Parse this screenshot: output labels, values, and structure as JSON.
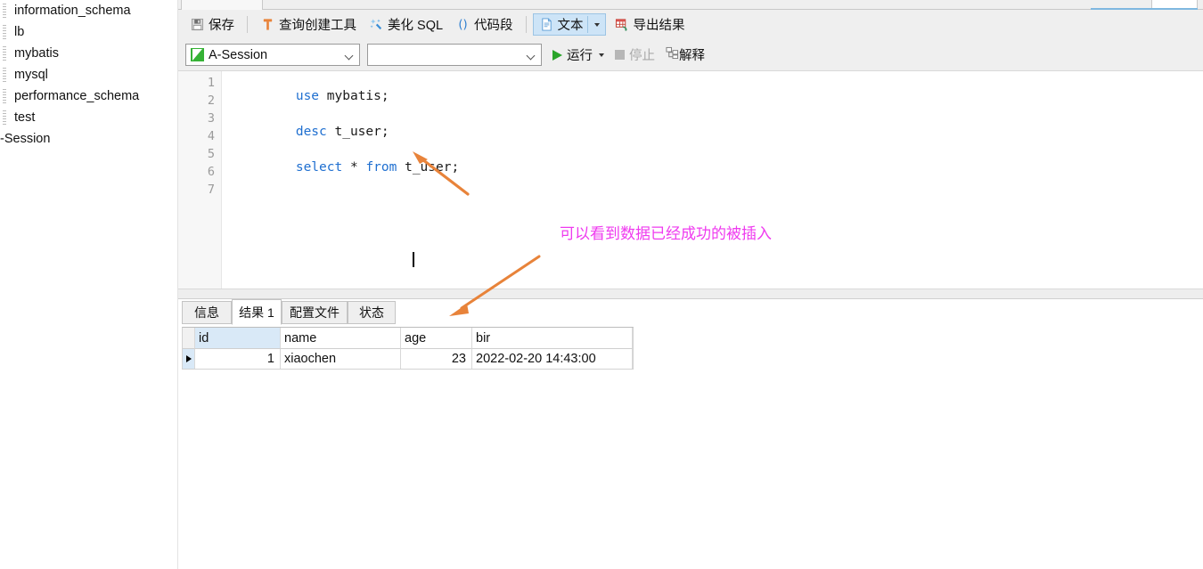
{
  "sidebar": {
    "items": [
      {
        "label": "information_schema",
        "icon": "database-icon"
      },
      {
        "label": "lb",
        "icon": "database-icon"
      },
      {
        "label": "mybatis",
        "icon": "database-icon"
      },
      {
        "label": "mysql",
        "icon": "database-icon"
      },
      {
        "label": "performance_schema",
        "icon": "database-icon"
      },
      {
        "label": "test",
        "icon": "database-icon"
      },
      {
        "label": "-Session",
        "icon": "session-icon"
      }
    ]
  },
  "toolbar": {
    "save": "保存",
    "query_builder": "查询创建工具",
    "beautify_sql": "美化 SQL",
    "code_snippet": "代码段",
    "text_mode": "文本",
    "export_result": "导出结果",
    "icons": {
      "save": "floppy-disk-icon",
      "query_builder": "t-tool-icon",
      "beautify_sql": "magic-wand-icon",
      "code_snippet": "parentheses-icon",
      "text_mode": "document-icon",
      "export_result": "export-grid-icon",
      "dropdown": "chevron-down-icon"
    }
  },
  "session_bar": {
    "session_value": "A-Session",
    "blank_value": "",
    "run": "运行",
    "stop": "停止",
    "explain": "解释",
    "icons": {
      "session": "session-icon",
      "run": "play-icon",
      "stop": "stop-icon",
      "explain": "explain-icon",
      "run_dropdown": "chevron-down-icon"
    }
  },
  "editor": {
    "line_numbers": [
      "1",
      "2",
      "3",
      "4",
      "5",
      "6",
      "7"
    ],
    "lines": [
      {
        "n": 1,
        "tokens": [
          {
            "t": "use",
            "k": "kw"
          },
          {
            "t": " mybatis;",
            "k": "op"
          }
        ]
      },
      {
        "n": 2,
        "tokens": []
      },
      {
        "n": 3,
        "tokens": [
          {
            "t": "desc",
            "k": "kw"
          },
          {
            "t": " t_user;",
            "k": "op"
          }
        ]
      },
      {
        "n": 4,
        "tokens": []
      },
      {
        "n": 5,
        "tokens": [
          {
            "t": "select",
            "k": "kw"
          },
          {
            "t": " * ",
            "k": "op"
          },
          {
            "t": "from",
            "k": "kw"
          },
          {
            "t": " t_user;",
            "k": "op"
          }
        ]
      },
      {
        "n": 6,
        "tokens": []
      },
      {
        "n": 7,
        "tokens": []
      }
    ]
  },
  "result_tabs": [
    {
      "label": "信息",
      "active": false
    },
    {
      "label": "结果 1",
      "active": true
    },
    {
      "label": "配置文件",
      "active": false
    },
    {
      "label": "状态",
      "active": false
    }
  ],
  "result_grid": {
    "columns": [
      "id",
      "name",
      "age",
      "bir"
    ],
    "selected_column": "id",
    "rows": [
      {
        "id": "1",
        "name": "xiaochen",
        "age": "23",
        "bir": "2022-02-20 14:43:00"
      }
    ]
  },
  "annotations": {
    "note": "可以看到数据已经成功的被插入",
    "note_color": "#ef3bef",
    "arrow_color": "#e8833a"
  }
}
